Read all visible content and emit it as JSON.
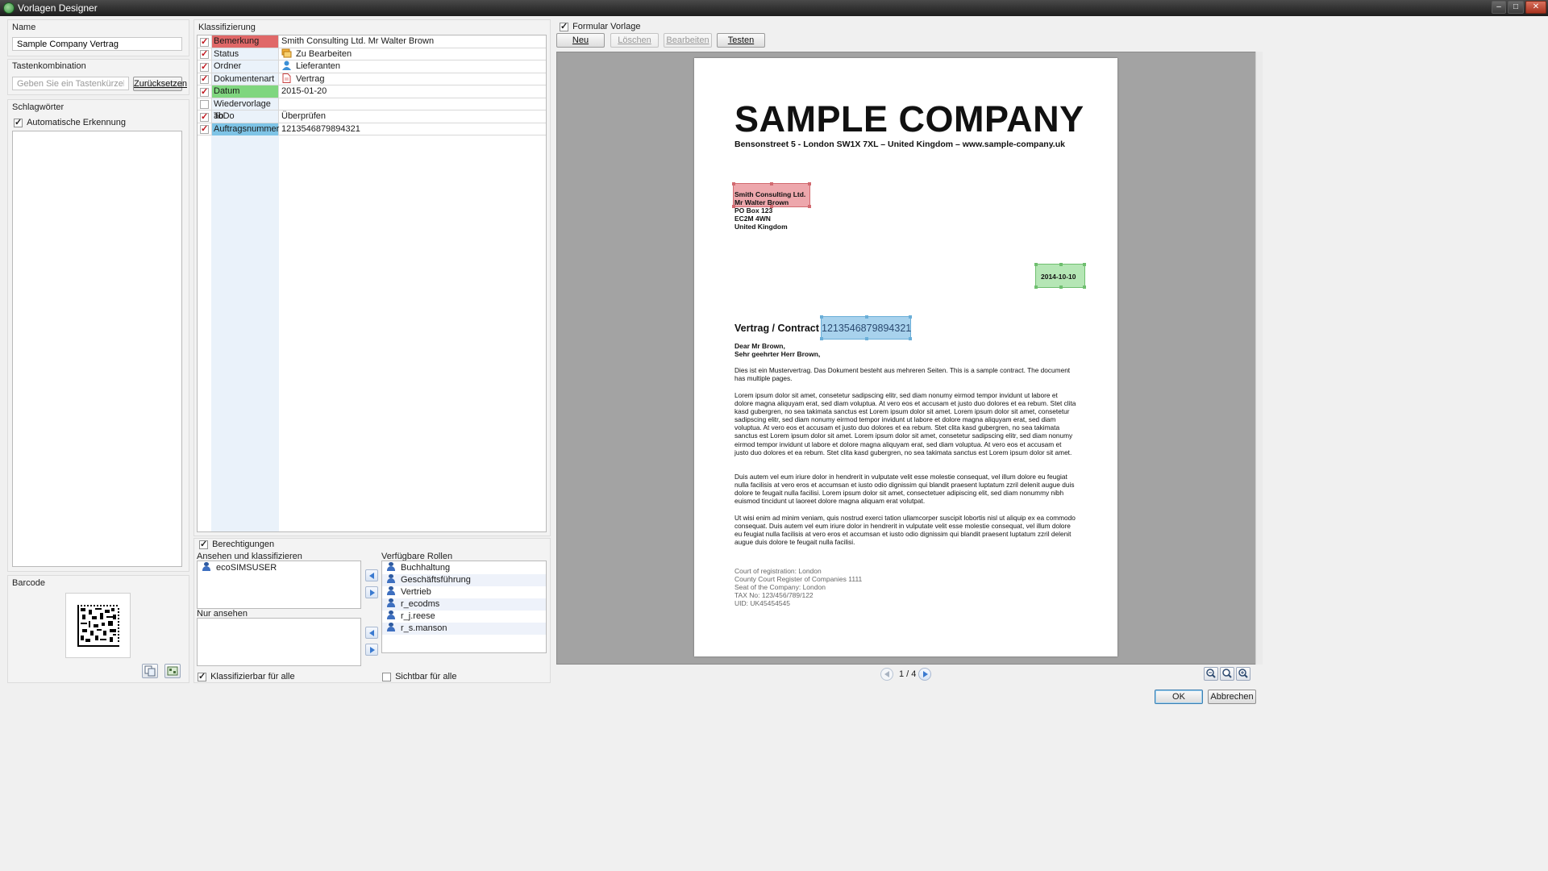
{
  "window": {
    "title": "Vorlagen Designer"
  },
  "name": {
    "label": "Name",
    "value": "Sample Company Vertrag"
  },
  "shortcut": {
    "label": "Tastenkombination",
    "placeholder": "Geben Sie ein Tastenkürzel ein",
    "reset": "Zurücksetzen"
  },
  "keywords": {
    "label": "Schlagwörter",
    "auto": "Automatische Erkennung",
    "auto_checked": true
  },
  "barcode": {
    "label": "Barcode"
  },
  "classification": {
    "label": "Klassifizierung",
    "rows": [
      {
        "key": "Bemerkung",
        "value": "Smith Consulting Ltd. Mr Walter Brown",
        "checked": true,
        "icon": "none",
        "color": "#e06868"
      },
      {
        "key": "Status",
        "value": "Zu Bearbeiten",
        "checked": true,
        "icon": "status-flag-icon",
        "color": ""
      },
      {
        "key": "Ordner",
        "value": "Lieferanten",
        "checked": true,
        "icon": "user-icon",
        "color": ""
      },
      {
        "key": "Dokumentenart",
        "value": "Vertrag",
        "checked": true,
        "icon": "document-icon",
        "color": ""
      },
      {
        "key": "Datum",
        "value": "2015-01-20",
        "checked": true,
        "icon": "none",
        "color": "#7fd67f"
      },
      {
        "key": "Wiedervorlage ab",
        "value": "",
        "checked": false,
        "icon": "none",
        "color": ""
      },
      {
        "key": "ToDo",
        "value": "Überprüfen",
        "checked": true,
        "icon": "none",
        "color": ""
      },
      {
        "key": "Auftragsnummer",
        "value": "1213546879894321",
        "checked": true,
        "icon": "none",
        "color": "#7ec4e6"
      }
    ]
  },
  "permissions": {
    "label": "Berechtigungen",
    "checked": true,
    "view_classify_label": "Ansehen und klassifizieren",
    "view_classify": [
      "ecoSIMSUSER"
    ],
    "view_only_label": "Nur ansehen",
    "view_only": [],
    "roles_label": "Verfügbare Rollen",
    "roles": [
      "Buchhaltung",
      "Geschäftsführung",
      "Vertrieb",
      "r_ecodms",
      "r_j.reese",
      "r_s.manson"
    ],
    "classify_all": "Klassifizierbar für alle",
    "classify_all_checked": true,
    "visible_all": "Sichtbar für alle",
    "visible_all_checked": false
  },
  "form_template": {
    "label": "Formular Vorlage",
    "checked": true,
    "buttons": {
      "new": "Neu",
      "delete": "Löschen",
      "edit": "Bearbeiten",
      "test": "Testen"
    }
  },
  "document": {
    "company": "SAMPLE COMPANY",
    "address_line": "Bensonstreet 5 -  London SW1X 7XL – United Kingdom – www.sample-company.uk",
    "recipient": [
      "Smith Consulting Ltd.",
      "Mr Walter Brown",
      "PO Box 123",
      "EC2M 4WN",
      "United Kingdom"
    ],
    "date": "2014-10-10",
    "subject": "Vertrag / Contract",
    "contract_no": "1213546879894321",
    "salutation": [
      "Dear Mr Brown,",
      "Sehr geehrter Herr Brown,"
    ],
    "paragraphs": [
      "Dies ist ein Mustervertrag. Das Dokument besteht aus mehreren Seiten. This is a sample contract. The document has multiple pages.",
      "Lorem ipsum dolor sit amet, consetetur sadipscing elitr, sed diam nonumy eirmod tempor invidunt ut labore et dolore magna aliquyam erat, sed diam voluptua. At vero eos et accusam et justo duo dolores et ea rebum. Stet clita kasd gubergren, no sea takimata sanctus est Lorem ipsum dolor sit amet. Lorem ipsum dolor sit amet, consetetur sadipscing elitr, sed diam nonumy eirmod tempor invidunt ut labore et dolore magna aliquyam erat, sed diam voluptua. At vero eos et accusam et justo duo dolores et ea rebum. Stet clita kasd gubergren, no sea takimata sanctus est Lorem ipsum dolor sit amet. Lorem ipsum dolor sit amet, consetetur sadipscing elitr, sed diam nonumy eirmod tempor invidunt ut labore et dolore magna aliquyam erat, sed diam voluptua. At vero eos et accusam et justo duo dolores et ea rebum. Stet clita kasd gubergren, no sea takimata sanctus est Lorem ipsum dolor sit amet.",
      "Duis autem vel eum iriure dolor in hendrerit in vulputate velit esse molestie consequat, vel illum dolore eu feugiat nulla facilisis at vero eros et accumsan et iusto odio dignissim qui blandit praesent luptatum zzril delenit augue duis dolore te feugait nulla facilisi. Lorem ipsum dolor sit amet, consectetuer adipiscing elit, sed diam nonummy nibh euismod tincidunt ut laoreet dolore magna aliquam erat volutpat.",
      "Ut wisi enim ad minim veniam, quis nostrud exerci tation ullamcorper suscipit lobortis nisl ut aliquip ex ea commodo consequat. Duis autem vel eum iriure dolor in hendrerit in vulputate velit esse molestie consequat, vel illum dolore eu feugiat nulla facilisis at vero eros et accumsan et iusto odio dignissim qui blandit praesent luptatum zzril delenit augue duis dolore te feugait nulla facilisi."
    ],
    "footer": [
      "Court of registration: London",
      "County Court Register of Companies 1111",
      "Seat of the Company: London",
      "TAX No: 123/456/789/122",
      "UID: UK45454545"
    ]
  },
  "pager": {
    "text": "1 / 4"
  },
  "dialog": {
    "ok": "OK",
    "cancel": "Abbrechen"
  }
}
